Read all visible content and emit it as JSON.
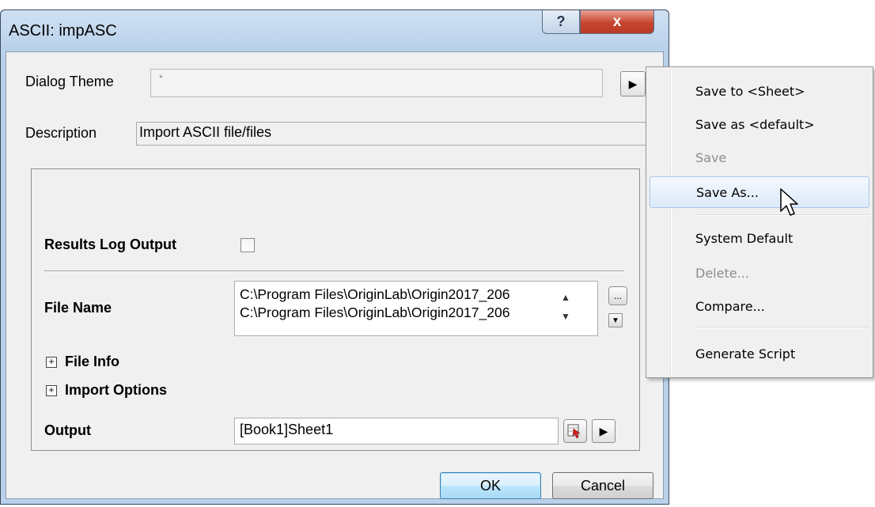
{
  "window": {
    "title": "ASCII: impASC",
    "help_glyph": "?",
    "close_glyph": "x"
  },
  "header": {
    "dialog_theme_label": "Dialog Theme",
    "dialog_theme_value": "*",
    "theme_menu_glyph": "▶",
    "description_label": "Description",
    "description_value": "Import ASCII file/files"
  },
  "panel": {
    "results_log_label": "Results Log Output",
    "results_log_checked": false,
    "file_name_label": "File Name",
    "file_names": [
      "C:\\Program Files\\OriginLab\\Origin2017_206",
      "C:\\Program Files\\OriginLab\\Origin2017_206"
    ],
    "browse_glyph": "...",
    "scroll_up_glyph": "▲",
    "scroll_down_glyph": "▼",
    "dropdown_glyph": "▼",
    "file_info_label": "File Info",
    "import_options_label": "Import Options",
    "expander_glyph": "+",
    "output_label": "Output",
    "output_value": "[Book1]Sheet1",
    "output_menu_glyph": "▶"
  },
  "buttons": {
    "ok": "OK",
    "cancel": "Cancel"
  },
  "menu": {
    "items": [
      {
        "label": "Save to <Sheet>",
        "enabled": true
      },
      {
        "label": "Save as <default>",
        "enabled": true
      },
      {
        "label": "Save",
        "enabled": false
      },
      {
        "label": "Save As...",
        "enabled": true,
        "highlighted": true
      },
      {
        "label": "System Default",
        "enabled": true
      },
      {
        "label": "Delete...",
        "enabled": false
      },
      {
        "label": "Compare...",
        "enabled": true
      },
      {
        "label": "Generate Script",
        "enabled": true
      }
    ]
  },
  "colors": {
    "frame": "#b9d1ea",
    "close_button": "#c6452f",
    "menu_highlight": "#dceaf9",
    "default_button": "#bee6fd"
  }
}
